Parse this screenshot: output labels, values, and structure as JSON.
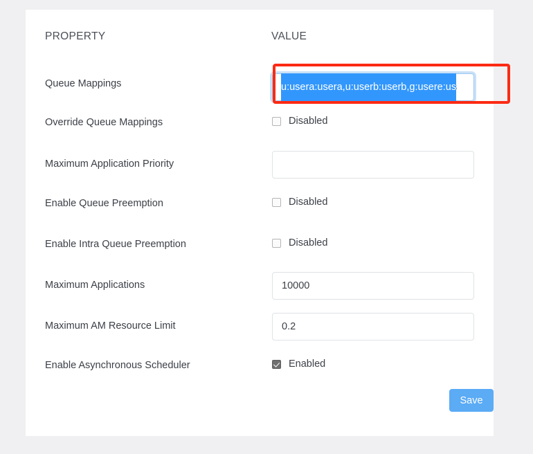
{
  "table": {
    "header": {
      "property": "PROPERTY",
      "value": "VALUE"
    },
    "rows": [
      {
        "label": "Queue Mappings",
        "control": "text",
        "value": "u:usera:usera,u:userb:userb,g:usere:us",
        "placeholder": "",
        "selected": true,
        "highlighted": true
      },
      {
        "label": "Override Queue Mappings",
        "control": "checkbox",
        "checked": false,
        "state_label": "Disabled"
      },
      {
        "label": "Maximum Application Priority",
        "control": "text",
        "value": "",
        "placeholder": ""
      },
      {
        "label": "Enable Queue Preemption",
        "control": "checkbox",
        "checked": false,
        "state_label": "Disabled"
      },
      {
        "label": "Enable Intra Queue Preemption",
        "control": "checkbox",
        "checked": false,
        "state_label": "Disabled"
      },
      {
        "label": "Maximum Applications",
        "control": "text",
        "value": "10000",
        "placeholder": ""
      },
      {
        "label": "Maximum AM Resource Limit",
        "control": "text",
        "value": "0.2",
        "placeholder": ""
      },
      {
        "label": "Enable Asynchronous Scheduler",
        "control": "checkbox",
        "checked": true,
        "state_label": "Enabled"
      }
    ]
  },
  "actions": {
    "save_label": "Save"
  },
  "colors": {
    "page_background": "#f0f0f2",
    "card_background": "#ffffff",
    "accent_button": "#5babf5",
    "annotation_box": "#fc2a13",
    "selection_highlight": "#3297fd",
    "input_border": "#e0e2e5",
    "focus_ring": "#9ecaf2"
  }
}
